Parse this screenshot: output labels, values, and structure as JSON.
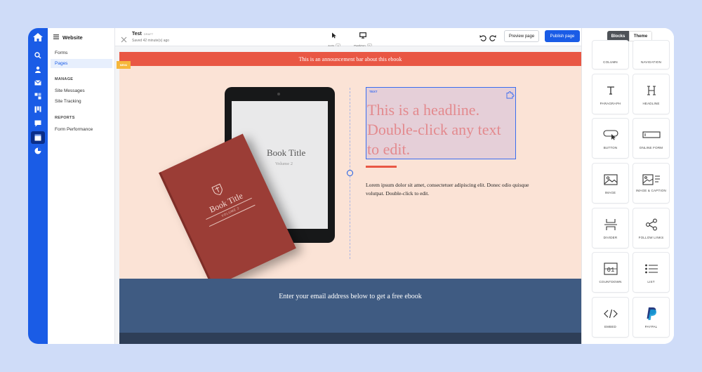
{
  "sidebar": {
    "header_label": "Website",
    "items": [
      {
        "label": "Forms"
      },
      {
        "label": "Pages"
      },
      {
        "label": "Site Messages"
      },
      {
        "label": "Site Tracking"
      },
      {
        "label": "Form Performance"
      }
    ],
    "sections": [
      "MANAGE",
      "REPORTS"
    ]
  },
  "topbar": {
    "title": "Test",
    "badge": "DRAFT",
    "saved": "Saved 42 minute(s) ago",
    "viewports": [
      {
        "label": "Auto",
        "key": "A"
      },
      {
        "label": "Desktop",
        "key": "D"
      }
    ],
    "preview_label": "Preview page",
    "publish_label": "Publish page"
  },
  "canvas": {
    "announcement": "This is an announcement bar about this ebook",
    "ribbon": "MENU",
    "tablet_title": "Book Title",
    "tablet_subtitle": "Volume 2",
    "book_title": "Book Title",
    "book_volume": "VOLUME 2",
    "text_tag": "TEXT",
    "headline": "This is a headline. Double-click any text to edit.",
    "body": "Lorem ipsum dolor sit amet, consectetuer adipiscing elit. Donec odio quisque volutpat. Double-click to edit.",
    "cta": "Enter your email address below to get a free ebook"
  },
  "panel": {
    "tabs": [
      "Blocks",
      "Theme"
    ],
    "blocks": [
      "COLUMN",
      "NAVIGATION",
      "PARAGRAPH",
      "HEADLINE",
      "BUTTON",
      "ONLINE FORM",
      "IMAGE",
      "IMAGE & CAPTION",
      "DIVIDER",
      "FOLLOW LINKS",
      "COUNTDOWN",
      "LIST",
      "EMBED",
      "PAYPAL"
    ]
  },
  "colors": {
    "accent": "#1a5ce6",
    "announcement": "#e95744",
    "hero": "#fbe3d6",
    "cta": "#3f5b82"
  }
}
